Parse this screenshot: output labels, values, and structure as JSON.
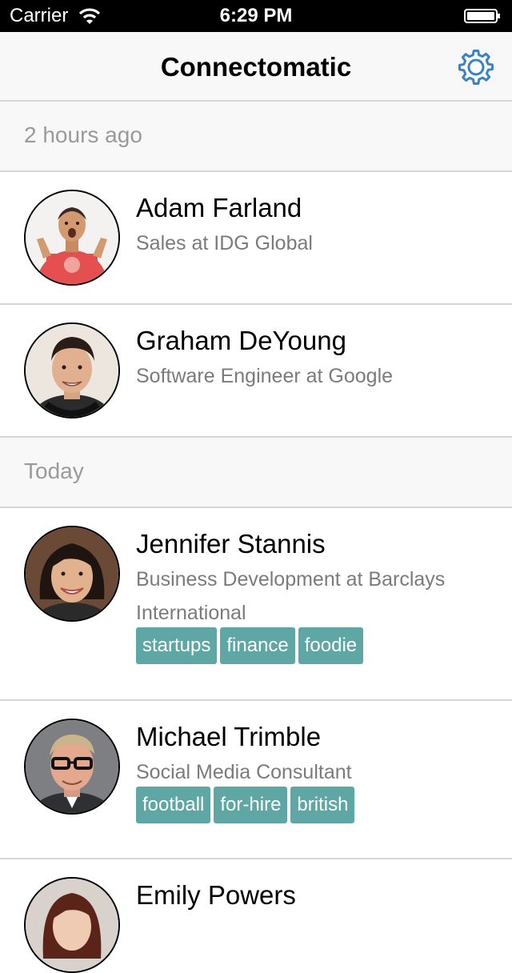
{
  "status_bar": {
    "carrier": "Carrier",
    "time": "6:29 PM"
  },
  "nav": {
    "title": "Connectomatic",
    "settings_icon": "gear-icon",
    "accent_color": "#3b82c4"
  },
  "sections": [
    {
      "header": "2 hours ago",
      "people": [
        {
          "name": "Adam Farland",
          "title": "Sales at IDG Global",
          "tags": []
        },
        {
          "name": "Graham DeYoung",
          "title": "Software Engineer at Google",
          "tags": []
        }
      ]
    },
    {
      "header": "Today",
      "people": [
        {
          "name": "Jennifer Stannis",
          "title": "Business Development at Barclays International",
          "tags": [
            "startups",
            "finance",
            "foodie"
          ]
        },
        {
          "name": "Michael Trimble",
          "title": "Social Media Consultant",
          "tags": [
            "football",
            "for-hire",
            "british"
          ]
        },
        {
          "name": "Emily Powers",
          "title": "",
          "tags": []
        }
      ]
    }
  ],
  "colors": {
    "tag_background": "#5fa7a5",
    "secondary_text": "#7b7b7b",
    "section_header_text": "#9a9a9a"
  }
}
